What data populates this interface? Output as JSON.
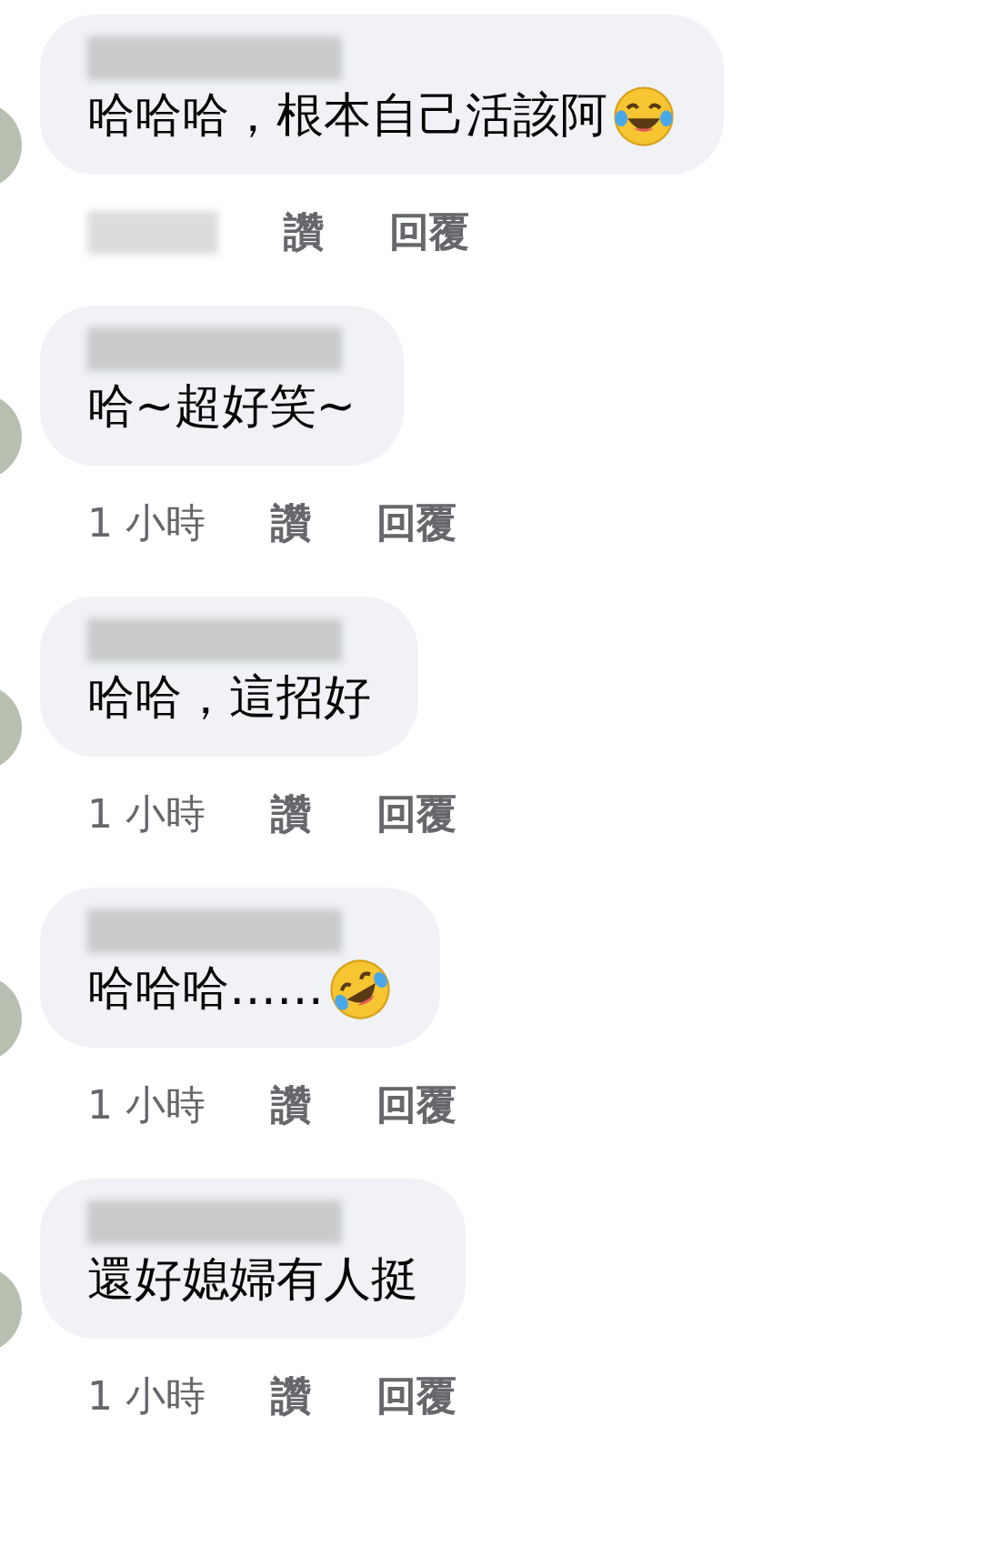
{
  "comments": [
    {
      "text": "哈哈哈，根本自己活該阿",
      "kind": "tears",
      "actions": [
        "讚",
        "回覆"
      ]
    },
    {
      "text": "哈~超好笑~",
      "kind": "plain",
      "time": "1 小時",
      "actions": [
        "讚",
        "回覆"
      ]
    },
    {
      "text": "哈哈，這招好",
      "kind": "plain",
      "time": "1 小時",
      "actions": [
        "讚",
        "回覆"
      ]
    },
    {
      "text": "哈哈哈……",
      "kind": "rolling",
      "time": "1 小時",
      "actions": [
        "讚",
        "回覆"
      ]
    },
    {
      "text": "還好媳婦有人挺",
      "kind": "plain",
      "time": "1 小時",
      "actions": [
        "讚",
        "回覆"
      ]
    }
  ]
}
